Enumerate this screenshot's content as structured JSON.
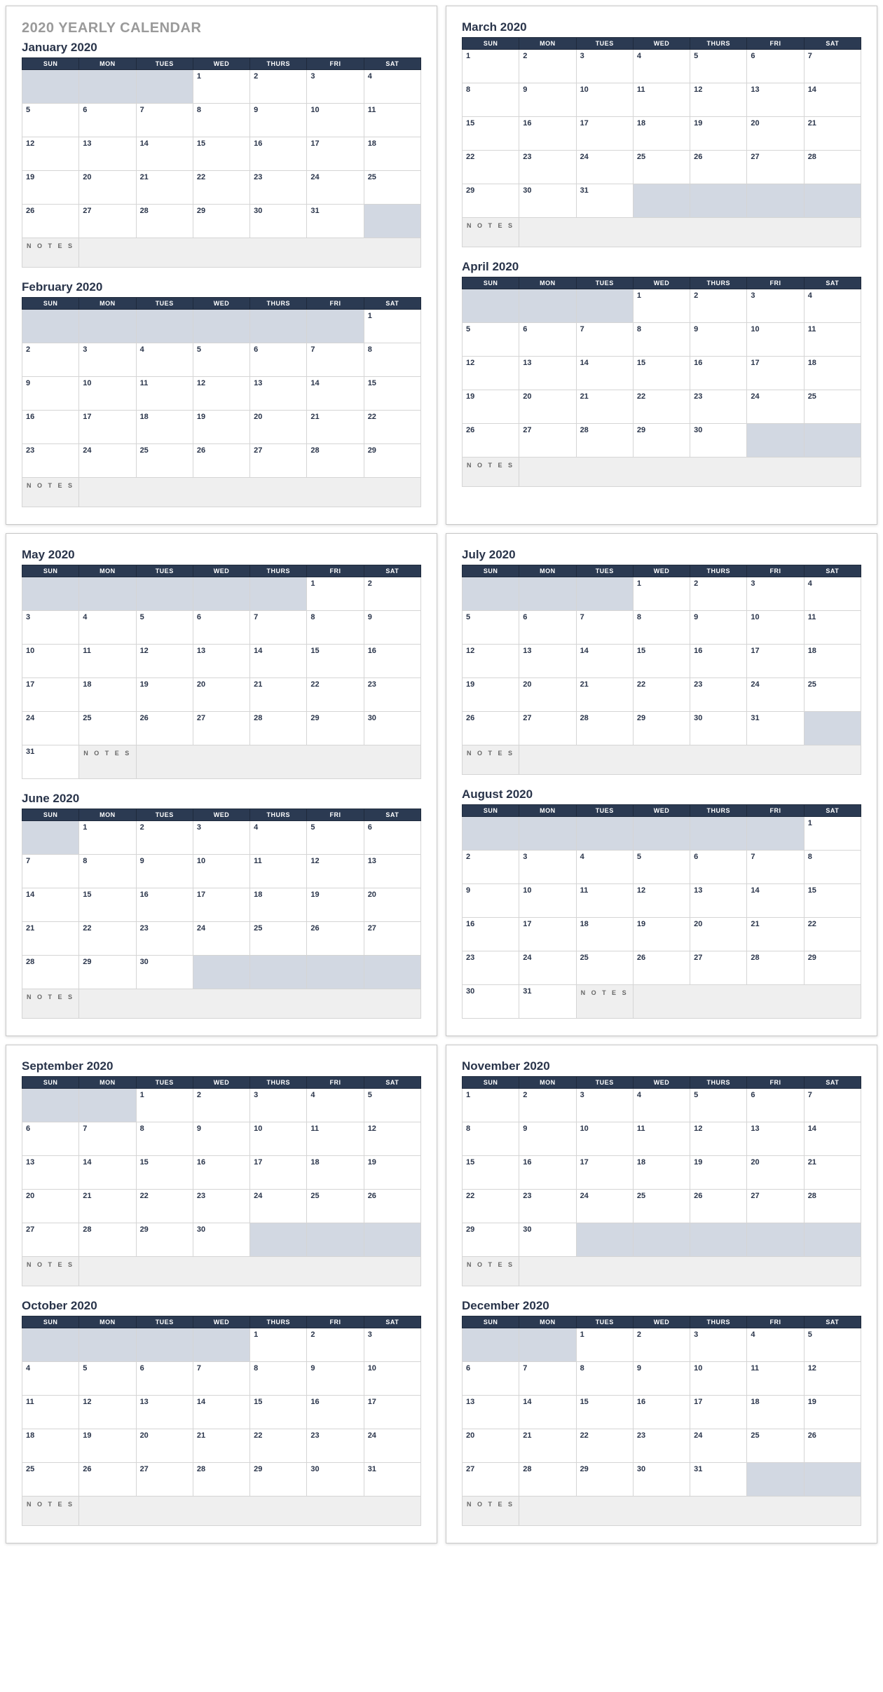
{
  "header": {
    "title": "2020 YEARLY CALENDAR"
  },
  "daysOfWeek": [
    "SUN",
    "MON",
    "TUES",
    "WED",
    "THURS",
    "FRI",
    "SAT"
  ],
  "notesLabel": "N O T E S",
  "pages": [
    {
      "showHeader": true,
      "months": [
        {
          "name": "January 2020",
          "startDay": 3,
          "numDays": 31
        },
        {
          "name": "February 2020",
          "startDay": 6,
          "numDays": 29
        }
      ]
    },
    {
      "showHeader": false,
      "months": [
        {
          "name": "March 2020",
          "startDay": 0,
          "numDays": 31
        },
        {
          "name": "April 2020",
          "startDay": 3,
          "numDays": 30
        }
      ]
    },
    {
      "showHeader": false,
      "months": [
        {
          "name": "May 2020",
          "startDay": 5,
          "numDays": 31
        },
        {
          "name": "June 2020",
          "startDay": 1,
          "numDays": 30
        }
      ]
    },
    {
      "showHeader": false,
      "months": [
        {
          "name": "July 2020",
          "startDay": 3,
          "numDays": 31
        },
        {
          "name": "August 2020",
          "startDay": 6,
          "numDays": 31
        }
      ]
    },
    {
      "showHeader": false,
      "months": [
        {
          "name": "September 2020",
          "startDay": 2,
          "numDays": 30
        },
        {
          "name": "October 2020",
          "startDay": 4,
          "numDays": 31
        }
      ]
    },
    {
      "showHeader": false,
      "months": [
        {
          "name": "November 2020",
          "startDay": 0,
          "numDays": 30
        },
        {
          "name": "December 2020",
          "startDay": 2,
          "numDays": 31
        }
      ]
    }
  ]
}
